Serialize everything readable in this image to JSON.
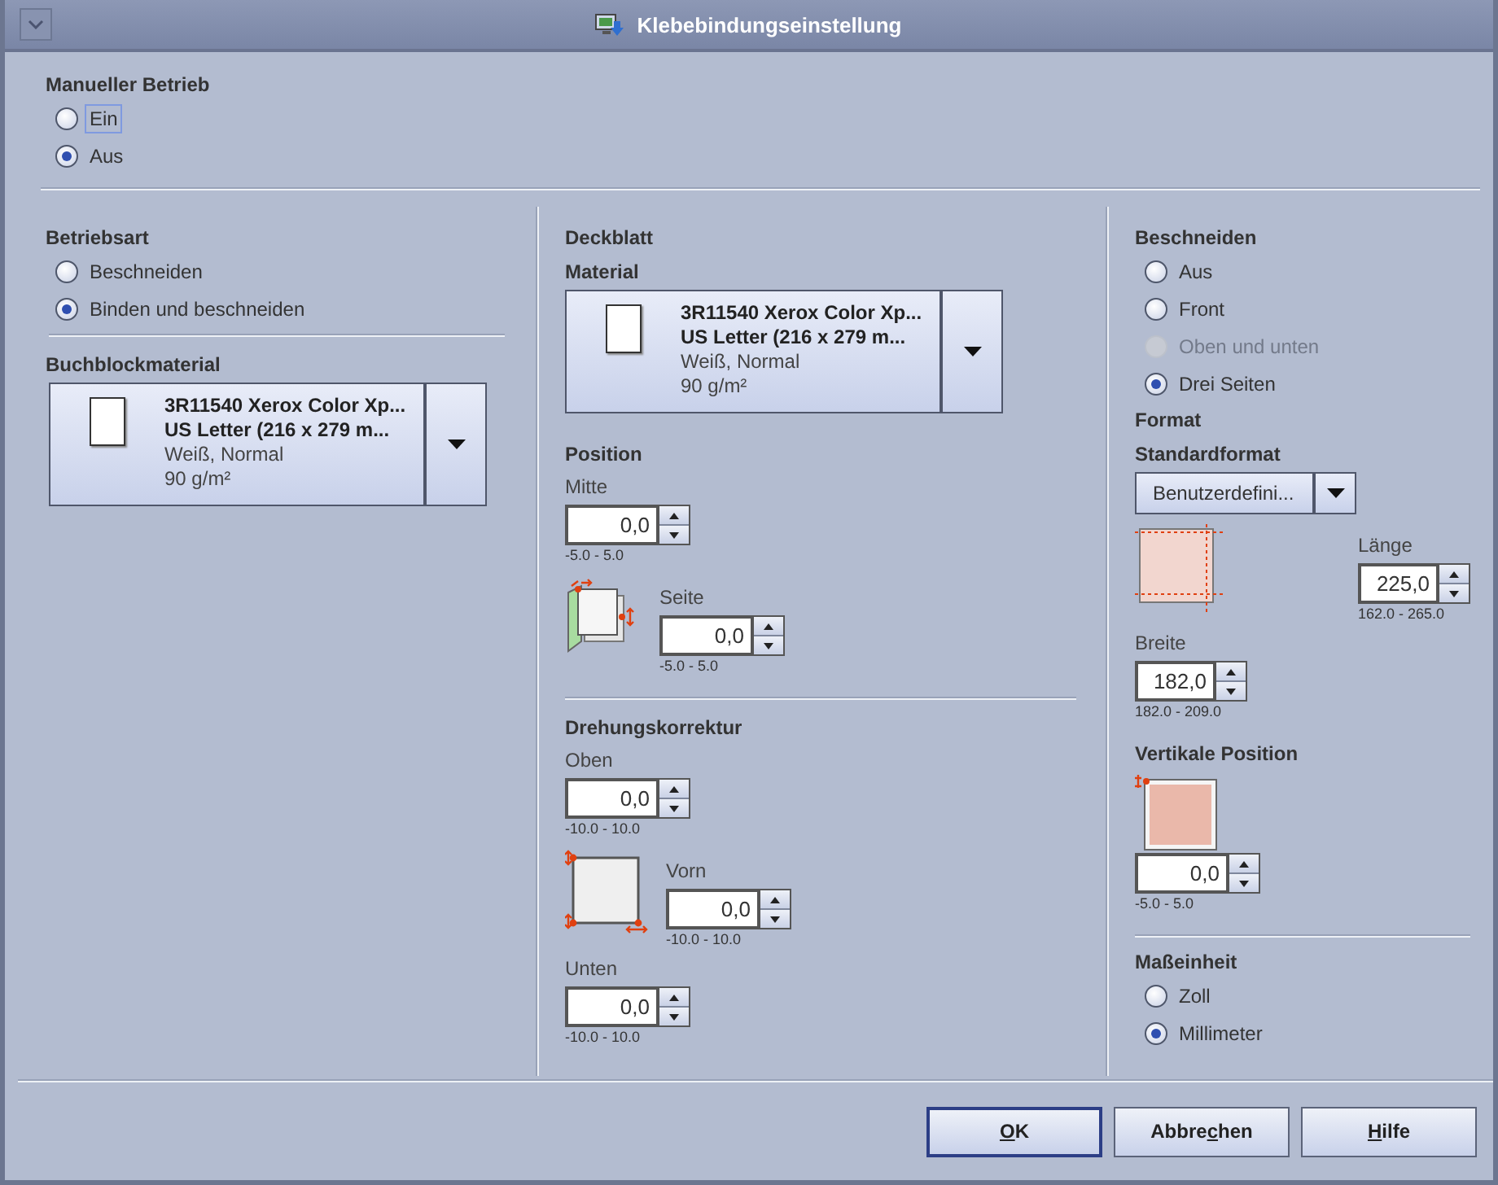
{
  "window": {
    "title": "Klebebindungseinstellung"
  },
  "manual": {
    "heading": "Manueller Betrieb",
    "options": [
      {
        "label": "Ein",
        "selected": false,
        "focused": true
      },
      {
        "label": "Aus",
        "selected": true,
        "focused": false
      }
    ]
  },
  "binding": {
    "heading": "Betriebsart",
    "options": [
      {
        "label": "Beschneiden",
        "selected": false
      },
      {
        "label": "Binden und beschneiden",
        "selected": true
      }
    ],
    "material": {
      "heading": "Buchblockmaterial",
      "name": "3R11540 Xerox Color Xp...",
      "size": "US Letter (216 x 279 m...",
      "finish": "Weiß, Normal",
      "weight": "90 g/m²"
    }
  },
  "cover": {
    "heading": "Deckblatt",
    "material": {
      "heading": "Material",
      "name": "3R11540 Xerox Color Xp...",
      "size": "US Letter (216 x 279 m...",
      "finish": "Weiß, Normal",
      "weight": "90 g/m²"
    },
    "position": {
      "heading": "Position",
      "center": {
        "label": "Mitte",
        "value": "0,0",
        "range": "-5.0 - 5.0"
      },
      "side": {
        "label": "Seite",
        "value": "0,0",
        "range": "-5.0 - 5.0"
      }
    },
    "rotation": {
      "heading": "Drehungskorrektur",
      "top": {
        "label": "Oben",
        "value": "0,0",
        "range": "-10.0 - 10.0"
      },
      "front": {
        "label": "Vorn",
        "value": "0,0",
        "range": "-10.0 - 10.0"
      },
      "bottom": {
        "label": "Unten",
        "value": "0,0",
        "range": "-10.0 - 10.0"
      }
    }
  },
  "trim": {
    "heading": "Beschneiden",
    "options": [
      {
        "label": "Aus",
        "selected": false,
        "disabled": false
      },
      {
        "label": "Front",
        "selected": false,
        "disabled": false
      },
      {
        "label": "Oben und unten",
        "selected": false,
        "disabled": true
      },
      {
        "label": "Drei Seiten",
        "selected": true,
        "disabled": false
      }
    ],
    "format": {
      "heading": "Format",
      "subheading": "Standardformat",
      "dropdown": "Benutzerdefini...",
      "length": {
        "label": "Länge",
        "value": "225,0",
        "range": "162.0 - 265.0"
      },
      "width": {
        "label": "Breite",
        "value": "182,0",
        "range": "182.0 - 209.0"
      }
    },
    "vertical": {
      "heading": "Vertikale Position",
      "value": "0,0",
      "range": "-5.0 - 5.0"
    },
    "units": {
      "heading": "Maßeinheit",
      "options": [
        {
          "label": "Zoll",
          "selected": false
        },
        {
          "label": "Millimeter",
          "selected": true
        }
      ]
    }
  },
  "buttons": [
    {
      "default": true,
      "parts": [
        {
          "text": "O",
          "underline": true
        },
        {
          "text": "K",
          "underline": false
        }
      ]
    },
    {
      "default": false,
      "parts": [
        {
          "text": "Abbre",
          "underline": false
        },
        {
          "text": "c",
          "underline": true
        },
        {
          "text": "hen",
          "underline": false
        }
      ]
    },
    {
      "default": false,
      "parts": [
        {
          "text": "H",
          "underline": true
        },
        {
          "text": "ilfe",
          "underline": false
        }
      ]
    }
  ]
}
